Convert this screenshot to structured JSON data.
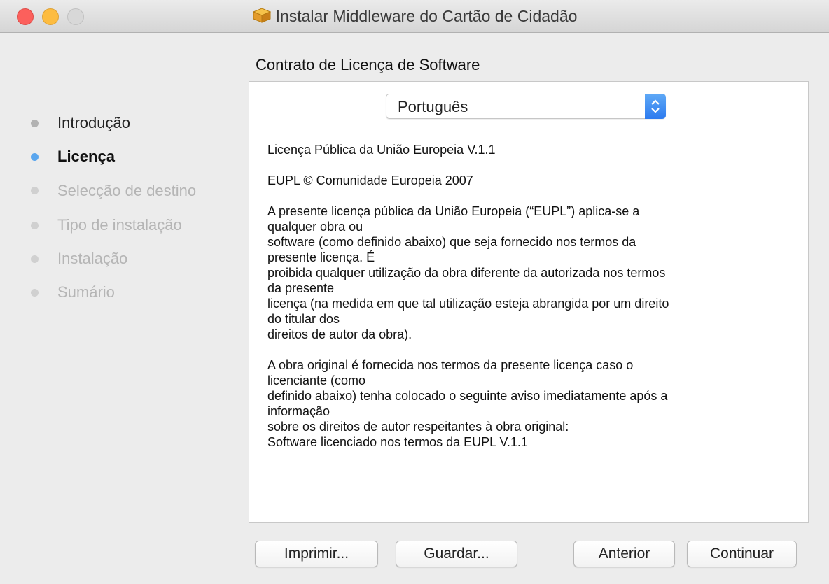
{
  "window": {
    "title": "Instalar Middleware do Cartão de Cidadão",
    "icon": "package-icon"
  },
  "sidebar": {
    "steps": [
      {
        "label": "Introdução",
        "state": "done"
      },
      {
        "label": "Licença",
        "state": "active"
      },
      {
        "label": "Selecção de destino",
        "state": "pending"
      },
      {
        "label": "Tipo de instalação",
        "state": "pending"
      },
      {
        "label": "Instalação",
        "state": "pending"
      },
      {
        "label": "Sumário",
        "state": "pending"
      }
    ]
  },
  "main": {
    "section_title": "Contrato de Licença de Software",
    "language_select": {
      "value": "Português"
    },
    "license_paragraphs": [
      [
        "Licença Pública da União Europeia V.1.1"
      ],
      [
        "EUPL © Comunidade Europeia 2007"
      ],
      [
        "A presente licença pública da União Europeia (“EUPL”) aplica-se a",
        "qualquer obra ou",
        "software (como definido abaixo) que seja fornecido nos termos da",
        "presente licença. É",
        "proibida qualquer utilização da obra diferente da autorizada nos termos",
        "da presente",
        "licença (na medida em que tal utilização esteja abrangida por um direito",
        "do titular dos",
        "direitos de autor da obra)."
      ],
      [
        "A obra original é fornecida nos termos da presente licença caso o",
        "licenciante (como",
        "definido abaixo) tenha colocado o seguinte aviso imediatamente após a",
        "informação",
        "sobre os direitos de autor respeitantes à obra original:",
        "Software licenciado nos termos da EUPL V.1.1"
      ]
    ]
  },
  "buttons": {
    "print": "Imprimir...",
    "save": "Guardar...",
    "back": "Anterior",
    "continue": "Continuar"
  },
  "colors": {
    "active_step_dot": "#5aa6ee",
    "close": "#fc605c",
    "minimize": "#fdbc40",
    "select_accent": "#2d7bef"
  }
}
